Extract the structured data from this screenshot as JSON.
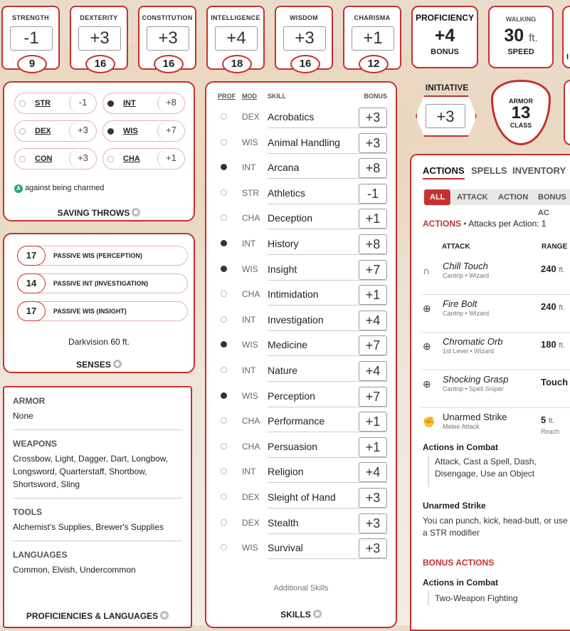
{
  "abilities": [
    {
      "name": "STRENGTH",
      "mod": "-1",
      "score": "9"
    },
    {
      "name": "DEXTERITY",
      "mod": "+3",
      "score": "16"
    },
    {
      "name": "CONSTITUTION",
      "mod": "+3",
      "score": "16"
    },
    {
      "name": "INTELLIGENCE",
      "mod": "+4",
      "score": "18"
    },
    {
      "name": "WISDOM",
      "mod": "+3",
      "score": "16"
    },
    {
      "name": "CHARISMA",
      "mod": "+1",
      "score": "12"
    }
  ],
  "proficiency": {
    "top": "PROFICIENCY",
    "value": "+4",
    "bottom": "BONUS"
  },
  "speed": {
    "top": "WALKING",
    "value": "30",
    "unit": "ft.",
    "bottom": "SPEED"
  },
  "cut_header": "I",
  "initiative": {
    "label": "INITIATIVE",
    "value": "+3"
  },
  "armor": {
    "top": "ARMOR",
    "value": "13",
    "bottom": "CLASS"
  },
  "saving_throws": {
    "items": [
      {
        "ab": "STR",
        "val": "-1",
        "prof": false
      },
      {
        "ab": "INT",
        "val": "+8",
        "prof": true
      },
      {
        "ab": "DEX",
        "val": "+3",
        "prof": false
      },
      {
        "ab": "WIS",
        "val": "+7",
        "prof": true
      },
      {
        "ab": "CON",
        "val": "+3",
        "prof": false
      },
      {
        "ab": "CHA",
        "val": "+1",
        "prof": false
      }
    ],
    "note_badge": "A",
    "note": "against being charmed",
    "title": "SAVING THROWS"
  },
  "senses": {
    "items": [
      {
        "val": "17",
        "label": "PASSIVE WIS (PERCEPTION)"
      },
      {
        "val": "14",
        "label": "PASSIVE INT (INVESTIGATION)"
      },
      {
        "val": "17",
        "label": "PASSIVE WIS (INSIGHT)"
      }
    ],
    "note": "Darkvision 60 ft.",
    "title": "SENSES"
  },
  "proficiencies": {
    "armor_h": "ARMOR",
    "armor": "None",
    "weapons_h": "WEAPONS",
    "weapons": "Crossbow, Light, Dagger, Dart, Longbow, Longsword, Quarterstaff, Shortbow, Shortsword, Sling",
    "tools_h": "TOOLS",
    "tools": "Alchemist's Supplies, Brewer's Supplies",
    "languages_h": "LANGUAGES",
    "languages": "Common, Elvish, Undercommon",
    "title": "PROFICIENCIES & LANGUAGES"
  },
  "skills": {
    "headers": {
      "prof": "PROF",
      "mod": "MOD",
      "skill": "SKILL",
      "bonus": "BONUS"
    },
    "items": [
      {
        "mod": "DEX",
        "name": "Acrobatics",
        "bonus": "+3",
        "prof": false
      },
      {
        "mod": "WIS",
        "name": "Animal Handling",
        "bonus": "+3",
        "prof": false
      },
      {
        "mod": "INT",
        "name": "Arcana",
        "bonus": "+8",
        "prof": true
      },
      {
        "mod": "STR",
        "name": "Athletics",
        "bonus": "-1",
        "prof": false
      },
      {
        "mod": "CHA",
        "name": "Deception",
        "bonus": "+1",
        "prof": false
      },
      {
        "mod": "INT",
        "name": "History",
        "bonus": "+8",
        "prof": true
      },
      {
        "mod": "WIS",
        "name": "Insight",
        "bonus": "+7",
        "prof": true
      },
      {
        "mod": "CHA",
        "name": "Intimidation",
        "bonus": "+1",
        "prof": false
      },
      {
        "mod": "INT",
        "name": "Investigation",
        "bonus": "+4",
        "prof": false
      },
      {
        "mod": "WIS",
        "name": "Medicine",
        "bonus": "+7",
        "prof": true
      },
      {
        "mod": "INT",
        "name": "Nature",
        "bonus": "+4",
        "prof": false
      },
      {
        "mod": "WIS",
        "name": "Perception",
        "bonus": "+7",
        "prof": true
      },
      {
        "mod": "CHA",
        "name": "Performance",
        "bonus": "+1",
        "prof": false
      },
      {
        "mod": "CHA",
        "name": "Persuasion",
        "bonus": "+1",
        "prof": false
      },
      {
        "mod": "INT",
        "name": "Religion",
        "bonus": "+4",
        "prof": false
      },
      {
        "mod": "DEX",
        "name": "Sleight of Hand",
        "bonus": "+3",
        "prof": false
      },
      {
        "mod": "DEX",
        "name": "Stealth",
        "bonus": "+3",
        "prof": false
      },
      {
        "mod": "WIS",
        "name": "Survival",
        "bonus": "+3",
        "prof": false
      }
    ],
    "additional": "Additional Skills",
    "title": "SKILLS"
  },
  "actions": {
    "tabs": [
      "ACTIONS",
      "SPELLS",
      "INVENTORY"
    ],
    "filters": [
      "ALL",
      "ATTACK",
      "ACTION",
      "BONUS AC"
    ],
    "heading": "ACTIONS",
    "attacks_per": "Attacks per Action: 1",
    "col_attack": "ATTACK",
    "col_range": "RANGE",
    "attacks": [
      {
        "icon": "hand-icon",
        "glyph": "∩",
        "name": "Chill Touch",
        "sub": "Cantrip • Wizard",
        "range": "240",
        "unit": "ft.",
        "rsub": "",
        "italic": true
      },
      {
        "icon": "spell-icon",
        "glyph": "⊕",
        "name": "Fire Bolt",
        "sub": "Cantrip • Wizard",
        "range": "240",
        "unit": "ft.",
        "rsub": "",
        "italic": true
      },
      {
        "icon": "spell-icon",
        "glyph": "⊕",
        "name": "Chromatic Orb",
        "sub": "1st Level • Wizard",
        "range": "180",
        "unit": "ft.",
        "rsub": "",
        "italic": true
      },
      {
        "icon": "spell-icon",
        "glyph": "⊕",
        "name": "Shocking Grasp",
        "sub": "Cantrip • Spell Sniper",
        "range": "Touch",
        "unit": "",
        "rsub": "",
        "italic": true
      },
      {
        "icon": "fist-icon",
        "glyph": "✊",
        "name": "Unarmed Strike",
        "sub": "Melee Attack",
        "range": "5",
        "unit": "ft.",
        "rsub": "Reach",
        "italic": false
      }
    ],
    "combat_h": "Actions in Combat",
    "combat_text": "Attack, Cast a Spell, Dash, Disengage, Use an Object",
    "unarmed_h": "Unarmed Strike",
    "unarmed_text": "You can punch, kick, head-butt, or use a STR modifier",
    "bonus_heading": "BONUS ACTIONS",
    "bonus_combat_h": "Actions in Combat",
    "bonus_combat_text": "Two-Weapon Fighting"
  },
  "colors": {
    "accent": "#c53131",
    "active_filter": "#c53131"
  }
}
